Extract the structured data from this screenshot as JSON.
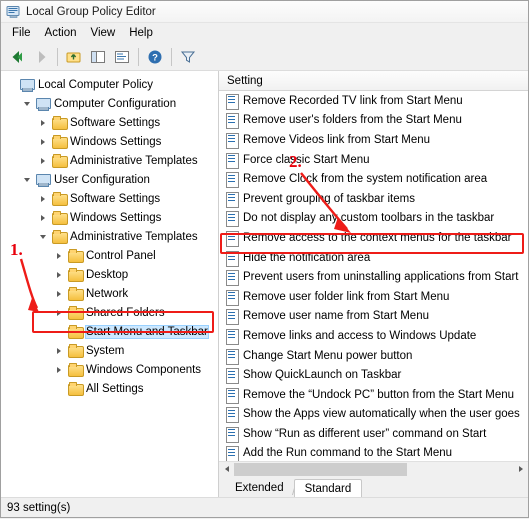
{
  "window": {
    "title": "Local Group Policy Editor",
    "titlebar_icon": "group-policy-icon"
  },
  "menubar": {
    "items": [
      {
        "label": "File"
      },
      {
        "label": "Action"
      },
      {
        "label": "View"
      },
      {
        "label": "Help"
      }
    ]
  },
  "toolbar": {
    "buttons": [
      {
        "name": "back-icon",
        "glyph": "◀"
      },
      {
        "name": "forward-icon",
        "glyph": "▶"
      },
      {
        "name": "up-one-level-icon",
        "glyph": "↑"
      },
      {
        "name": "show-hide-tree-icon",
        "glyph": "▤"
      },
      {
        "name": "properties-icon",
        "glyph": "▦"
      },
      {
        "name": "help-icon",
        "glyph": "?"
      },
      {
        "name": "filter-icon",
        "glyph": "▽"
      }
    ]
  },
  "tree": {
    "items": [
      {
        "label": "Local Computer Policy",
        "indent": 0,
        "twisty": "none",
        "icon": "computer-icon",
        "selected": false
      },
      {
        "label": "Computer Configuration",
        "indent": 1,
        "twisty": "down",
        "icon": "computer-icon",
        "selected": false
      },
      {
        "label": "Software Settings",
        "indent": 2,
        "twisty": "right",
        "icon": "folder-icon",
        "selected": false
      },
      {
        "label": "Windows Settings",
        "indent": 2,
        "twisty": "right",
        "icon": "folder-icon",
        "selected": false
      },
      {
        "label": "Administrative Templates",
        "indent": 2,
        "twisty": "right",
        "icon": "folder-icon",
        "selected": false
      },
      {
        "label": "User Configuration",
        "indent": 1,
        "twisty": "down",
        "icon": "computer-icon",
        "selected": false
      },
      {
        "label": "Software Settings",
        "indent": 2,
        "twisty": "right",
        "icon": "folder-icon",
        "selected": false
      },
      {
        "label": "Windows Settings",
        "indent": 2,
        "twisty": "right",
        "icon": "folder-icon",
        "selected": false
      },
      {
        "label": "Administrative Templates",
        "indent": 2,
        "twisty": "down",
        "icon": "folder-icon",
        "selected": false
      },
      {
        "label": "Control Panel",
        "indent": 3,
        "twisty": "right",
        "icon": "folder-icon",
        "selected": false
      },
      {
        "label": "Desktop",
        "indent": 3,
        "twisty": "right",
        "icon": "folder-icon",
        "selected": false
      },
      {
        "label": "Network",
        "indent": 3,
        "twisty": "right",
        "icon": "folder-icon",
        "selected": false
      },
      {
        "label": "Shared Folders",
        "indent": 3,
        "twisty": "right",
        "icon": "folder-icon",
        "selected": false
      },
      {
        "label": "Start Menu and Taskbar",
        "indent": 3,
        "twisty": "none",
        "icon": "folder-icon",
        "selected": true
      },
      {
        "label": "System",
        "indent": 3,
        "twisty": "right",
        "icon": "folder-icon",
        "selected": false
      },
      {
        "label": "Windows Components",
        "indent": 3,
        "twisty": "right",
        "icon": "folder-icon",
        "selected": false
      },
      {
        "label": "All Settings",
        "indent": 3,
        "twisty": "none",
        "icon": "folder-icon",
        "selected": false
      }
    ]
  },
  "list": {
    "column_header": "Setting",
    "rows": [
      {
        "label": "Remove Recorded TV link from Start Menu",
        "highlighted": false
      },
      {
        "label": "Remove user's folders from the Start Menu",
        "highlighted": false
      },
      {
        "label": "Remove Videos link from Start Menu",
        "highlighted": false
      },
      {
        "label": "Force classic Start Menu",
        "highlighted": false
      },
      {
        "label": "Remove Clock from the system notification area",
        "highlighted": false
      },
      {
        "label": "Prevent grouping of taskbar items",
        "highlighted": false
      },
      {
        "label": "Do not display any custom toolbars in the taskbar",
        "highlighted": false
      },
      {
        "label": "Remove access to the context menus for the taskbar",
        "highlighted": true
      },
      {
        "label": "Hide the notification area",
        "highlighted": false
      },
      {
        "label": "Prevent users from uninstalling applications from Start",
        "highlighted": false
      },
      {
        "label": "Remove user folder link from Start Menu",
        "highlighted": false
      },
      {
        "label": "Remove user name from Start Menu",
        "highlighted": false
      },
      {
        "label": "Remove links and access to Windows Update",
        "highlighted": false
      },
      {
        "label": "Change Start Menu power button",
        "highlighted": false
      },
      {
        "label": "Show QuickLaunch on Taskbar",
        "highlighted": false
      },
      {
        "label": "Remove the “Undock PC” button from the Start Menu",
        "highlighted": false
      },
      {
        "label": "Show the Apps view automatically when the user goes",
        "highlighted": false
      },
      {
        "label": "Show “Run as different user” command on Start",
        "highlighted": false
      },
      {
        "label": "Add the Run command to the Start Menu",
        "highlighted": false
      }
    ]
  },
  "tabs": [
    {
      "label": "Extended",
      "active": false
    },
    {
      "label": "Standard",
      "active": true
    }
  ],
  "statusbar": {
    "text": "93 setting(s)"
  },
  "annotations": [
    {
      "name": "callout-1",
      "label": "1."
    },
    {
      "name": "callout-2",
      "label": "2."
    }
  ],
  "colors": {
    "annotation_red": "#ee1c18",
    "selection_blue": "#cce8ff",
    "window_bg": "#f0f0f0"
  }
}
